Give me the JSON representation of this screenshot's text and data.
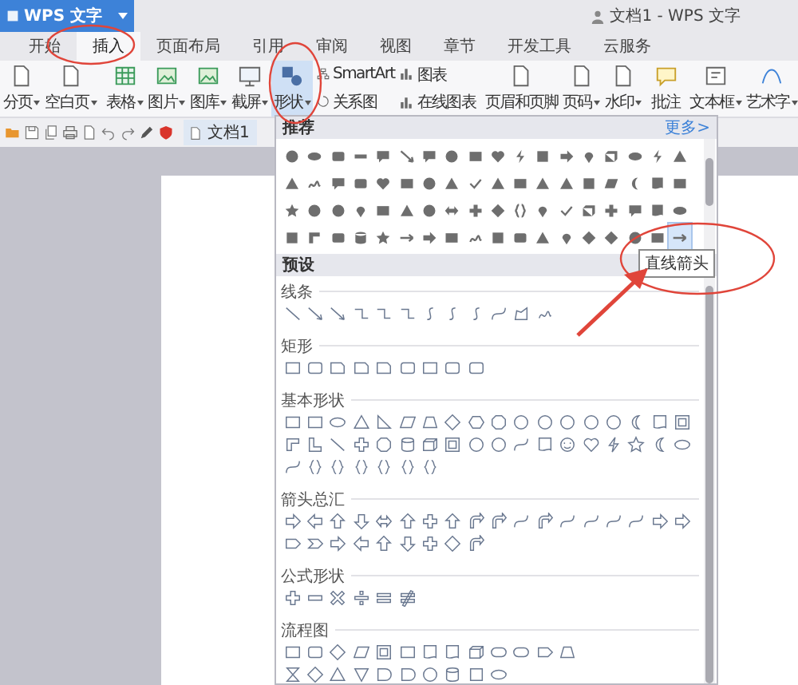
{
  "app_menu": {
    "label": "WPS 文字"
  },
  "window": {
    "title": "文档1 - WPS 文字"
  },
  "tabs": [
    {
      "label": "开始",
      "selected": false
    },
    {
      "label": "插入",
      "selected": true
    },
    {
      "label": "页面布局",
      "selected": false
    },
    {
      "label": "引用",
      "selected": false
    },
    {
      "label": "审阅",
      "selected": false
    },
    {
      "label": "视图",
      "selected": false
    },
    {
      "label": "章节",
      "selected": false
    },
    {
      "label": "开发工具",
      "selected": false
    },
    {
      "label": "云服务",
      "selected": false
    }
  ],
  "ribbon": [
    {
      "kind": "large",
      "label": "分页",
      "dropdown": true,
      "pressed": false
    },
    {
      "kind": "large",
      "label": "空白页",
      "dropdown": true,
      "pressed": false
    },
    {
      "kind": "separator"
    },
    {
      "kind": "large",
      "label": "表格",
      "dropdown": true,
      "pressed": false
    },
    {
      "kind": "large",
      "label": "图片",
      "dropdown": true,
      "pressed": false
    },
    {
      "kind": "large",
      "label": "图库",
      "dropdown": true,
      "pressed": false
    },
    {
      "kind": "large",
      "label": "截屏",
      "dropdown": true,
      "pressed": false
    },
    {
      "kind": "large",
      "label": "形状",
      "dropdown": true,
      "pressed": true
    },
    {
      "kind": "stack",
      "items": [
        {
          "label": "SmartArt"
        },
        {
          "label": "关系图"
        }
      ]
    },
    {
      "kind": "stack",
      "items": [
        {
          "label": "图表"
        },
        {
          "label": "在线图表"
        }
      ]
    },
    {
      "kind": "separator"
    },
    {
      "kind": "large",
      "label": "页眉和页脚",
      "dropdown": false,
      "pressed": false
    },
    {
      "kind": "large",
      "label": "页码",
      "dropdown": true,
      "pressed": false
    },
    {
      "kind": "large",
      "label": "水印",
      "dropdown": true,
      "pressed": false
    },
    {
      "kind": "separator"
    },
    {
      "kind": "large",
      "label": "批注",
      "dropdown": false,
      "pressed": false
    },
    {
      "kind": "separator"
    },
    {
      "kind": "large",
      "label": "文本框",
      "dropdown": true,
      "pressed": false
    },
    {
      "kind": "large",
      "label": "艺术字",
      "dropdown": true,
      "pressed": false
    }
  ],
  "quick_access": {
    "document_tab": {
      "label": "文档1"
    }
  },
  "shapes_panel": {
    "recommended": {
      "title": "推荐",
      "more_link": "更多>",
      "rows": [
        [
          {
            "kind": "circle",
            "selected": false
          },
          {
            "kind": "oval",
            "selected": false
          },
          {
            "kind": "rounded-rectangle",
            "selected": false
          },
          {
            "kind": "minus",
            "selected": false
          },
          {
            "kind": "speech-bubble",
            "selected": false
          },
          {
            "kind": "line-arrow",
            "selected": false
          },
          {
            "kind": "speech-bubble",
            "selected": false
          },
          {
            "kind": "circle",
            "selected": false
          },
          {
            "kind": "rectangle",
            "selected": false
          },
          {
            "kind": "heart",
            "selected": false
          },
          {
            "kind": "lightning",
            "selected": false
          },
          {
            "kind": "square",
            "selected": false
          },
          {
            "kind": "arrow",
            "selected": false
          },
          {
            "kind": "pin",
            "selected": false
          },
          {
            "kind": "cube",
            "selected": false
          },
          {
            "kind": "oval",
            "selected": false
          },
          {
            "kind": "lightning",
            "selected": false
          },
          {
            "kind": "triangle",
            "selected": false
          }
        ],
        [
          {
            "kind": "triangle",
            "selected": false
          },
          {
            "kind": "scribble",
            "selected": false
          },
          {
            "kind": "speech-bubble",
            "selected": false
          },
          {
            "kind": "rounded-rectangle",
            "selected": false
          },
          {
            "kind": "heart",
            "selected": false
          },
          {
            "kind": "rectangle",
            "selected": false
          },
          {
            "kind": "circle",
            "selected": false
          },
          {
            "kind": "triangle",
            "selected": false
          },
          {
            "kind": "check",
            "selected": false
          },
          {
            "kind": "triangle",
            "selected": false
          },
          {
            "kind": "rectangle",
            "selected": false
          },
          {
            "kind": "triangle",
            "selected": false
          },
          {
            "kind": "triangle",
            "selected": false
          },
          {
            "kind": "square",
            "selected": false
          },
          {
            "kind": "parallelogram",
            "selected": false
          },
          {
            "kind": "moon",
            "selected": false
          },
          {
            "kind": "document",
            "selected": false
          },
          {
            "kind": "rectangle",
            "selected": false
          }
        ],
        [
          {
            "kind": "star",
            "selected": false
          },
          {
            "kind": "circle",
            "selected": false
          },
          {
            "kind": "circle",
            "selected": false
          },
          {
            "kind": "pin",
            "selected": false
          },
          {
            "kind": "rectangle",
            "selected": false
          },
          {
            "kind": "triangle",
            "selected": false
          },
          {
            "kind": "circle",
            "selected": false
          },
          {
            "kind": "double-arrow",
            "selected": false
          },
          {
            "kind": "plus",
            "selected": false
          },
          {
            "kind": "diamond",
            "selected": false
          },
          {
            "kind": "bracket",
            "selected": false
          },
          {
            "kind": "pin",
            "selected": false
          },
          {
            "kind": "check",
            "selected": false
          },
          {
            "kind": "cube",
            "selected": false
          },
          {
            "kind": "plus",
            "selected": false
          },
          {
            "kind": "speech-bubble",
            "selected": false
          },
          {
            "kind": "document",
            "selected": false
          },
          {
            "kind": "oval",
            "selected": false
          }
        ],
        [
          {
            "kind": "square",
            "selected": false
          },
          {
            "kind": "corner",
            "selected": false
          },
          {
            "kind": "rounded-rectangle",
            "selected": false
          },
          {
            "kind": "cylinder",
            "selected": false
          },
          {
            "kind": "star",
            "selected": false
          },
          {
            "kind": "straight-arrow",
            "selected": false
          },
          {
            "kind": "arrow",
            "selected": false
          },
          {
            "kind": "rectangle",
            "selected": false
          },
          {
            "kind": "scribble",
            "selected": false
          },
          {
            "kind": "square",
            "selected": false
          },
          {
            "kind": "rounded-rectangle",
            "selected": false
          },
          {
            "kind": "triangle",
            "selected": false
          },
          {
            "kind": "pin",
            "selected": false
          },
          {
            "kind": "diamond",
            "selected": false
          },
          {
            "kind": "diamond",
            "selected": false
          },
          {
            "kind": "circle",
            "selected": false
          },
          {
            "kind": "rectangle",
            "selected": false
          },
          {
            "kind": "straight-arrow",
            "selected": true
          }
        ]
      ]
    },
    "presets_title": "预设",
    "sections": [
      {
        "title": "线条",
        "rows": [
          [
            {
              "kind": "line"
            },
            {
              "kind": "line-arrow"
            },
            {
              "kind": "line-arrow"
            },
            {
              "kind": "elbow"
            },
            {
              "kind": "elbow"
            },
            {
              "kind": "elbow"
            },
            {
              "kind": "s-curve"
            },
            {
              "kind": "s-curve"
            },
            {
              "kind": "s-curve"
            },
            {
              "kind": "curve"
            },
            {
              "kind": "freeform"
            },
            {
              "kind": "scribble"
            }
          ]
        ]
      },
      {
        "title": "矩形",
        "rows": [
          [
            {
              "kind": "rectangle"
            },
            {
              "kind": "rounded-rectangle"
            },
            {
              "kind": "snip-rectangle"
            },
            {
              "kind": "snip-rectangle"
            },
            {
              "kind": "snip-rectangle"
            },
            {
              "kind": "rounded-rectangle"
            },
            {
              "kind": "rectangle"
            },
            {
              "kind": "rounded-rectangle"
            },
            {
              "kind": "rounded-rectangle"
            }
          ]
        ]
      },
      {
        "title": "基本形状",
        "rows": [
          [
            {
              "kind": "rectangle"
            },
            {
              "kind": "rectangle"
            },
            {
              "kind": "oval"
            },
            {
              "kind": "triangle"
            },
            {
              "kind": "right-triangle"
            },
            {
              "kind": "parallelogram"
            },
            {
              "kind": "trapezoid"
            },
            {
              "kind": "diamond"
            },
            {
              "kind": "hexagon"
            },
            {
              "kind": "octagon"
            },
            {
              "kind": "circle"
            },
            {
              "kind": "circle"
            },
            {
              "kind": "circle"
            },
            {
              "kind": "circle"
            },
            {
              "kind": "circle"
            },
            {
              "kind": "moon"
            },
            {
              "kind": "document"
            },
            {
              "kind": "frame"
            }
          ],
          [
            {
              "kind": "corner"
            },
            {
              "kind": "l-shape"
            },
            {
              "kind": "line"
            },
            {
              "kind": "plus"
            },
            {
              "kind": "octagon"
            },
            {
              "kind": "cylinder"
            },
            {
              "kind": "cube"
            },
            {
              "kind": "frame"
            },
            {
              "kind": "circle"
            },
            {
              "kind": "circle"
            },
            {
              "kind": "curve"
            },
            {
              "kind": "document"
            },
            {
              "kind": "smiley"
            },
            {
              "kind": "heart"
            },
            {
              "kind": "lightning"
            },
            {
              "kind": "star"
            },
            {
              "kind": "moon"
            },
            {
              "kind": "oval"
            }
          ],
          [
            {
              "kind": "curve"
            },
            {
              "kind": "bracket"
            },
            {
              "kind": "bracket"
            },
            {
              "kind": "bracket"
            },
            {
              "kind": "bracket"
            },
            {
              "kind": "bracket"
            },
            {
              "kind": "bracket"
            }
          ]
        ]
      },
      {
        "title": "箭头总汇",
        "rows": [
          [
            {
              "kind": "arrow"
            },
            {
              "kind": "left-arrow"
            },
            {
              "kind": "up-arrow"
            },
            {
              "kind": "down-arrow"
            },
            {
              "kind": "double-arrow"
            },
            {
              "kind": "up-arrow"
            },
            {
              "kind": "plus"
            },
            {
              "kind": "up-arrow"
            },
            {
              "kind": "bent-arrow"
            },
            {
              "kind": "bent-arrow"
            },
            {
              "kind": "curve"
            },
            {
              "kind": "bent-arrow"
            },
            {
              "kind": "curve"
            },
            {
              "kind": "curve"
            },
            {
              "kind": "curve"
            },
            {
              "kind": "curve"
            },
            {
              "kind": "arrow"
            },
            {
              "kind": "arrow"
            }
          ],
          [
            {
              "kind": "pentagon"
            },
            {
              "kind": "chevron"
            },
            {
              "kind": "arrow"
            },
            {
              "kind": "left-arrow"
            },
            {
              "kind": "up-arrow"
            },
            {
              "kind": "down-arrow"
            },
            {
              "kind": "plus"
            },
            {
              "kind": "diamond"
            },
            {
              "kind": "bent-arrow"
            }
          ]
        ]
      },
      {
        "title": "公式形状",
        "rows": [
          [
            {
              "kind": "plus"
            },
            {
              "kind": "minus"
            },
            {
              "kind": "multiply"
            },
            {
              "kind": "divide"
            },
            {
              "kind": "equal"
            },
            {
              "kind": "not-equal"
            }
          ]
        ]
      },
      {
        "title": "流程图",
        "rows": [
          [
            {
              "kind": "rectangle"
            },
            {
              "kind": "rounded-rectangle"
            },
            {
              "kind": "diamond"
            },
            {
              "kind": "parallelogram"
            },
            {
              "kind": "frame"
            },
            {
              "kind": "rectangle"
            },
            {
              "kind": "document"
            },
            {
              "kind": "document"
            },
            {
              "kind": "cube"
            },
            {
              "kind": "stadium"
            },
            {
              "kind": "stadium"
            },
            {
              "kind": "pentagon"
            },
            {
              "kind": "trapezoid"
            }
          ],
          [
            {
              "kind": "hourglass"
            },
            {
              "kind": "diamond"
            },
            {
              "kind": "triangle"
            },
            {
              "kind": "inverted-triangle"
            },
            {
              "kind": "d-shape"
            },
            {
              "kind": "d-shape"
            },
            {
              "kind": "circle"
            },
            {
              "kind": "cylinder"
            },
            {
              "kind": "square"
            },
            {
              "kind": "oval"
            }
          ]
        ]
      }
    ],
    "tooltip": "直线箭头"
  }
}
